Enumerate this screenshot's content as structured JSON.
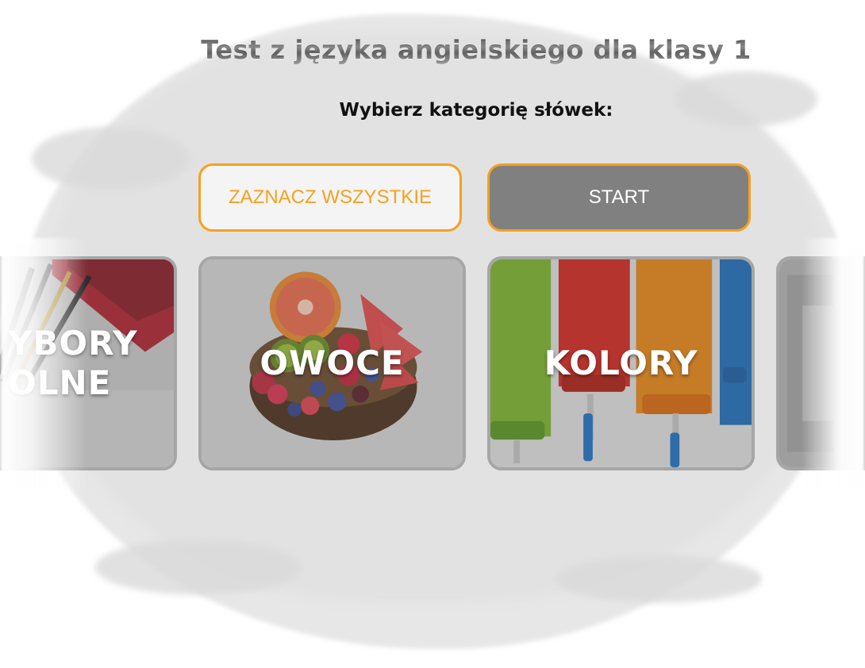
{
  "header": {
    "title": "Test z języka angielskiego dla klasy 1",
    "subtitle": "Wybierz kategorię słówek:"
  },
  "actions": {
    "select_all_label": "ZAZNACZ WSZYSTKIE",
    "start_label": "START"
  },
  "categories": [
    {
      "label": "PRZYBORY\nSZKOLNE",
      "visible_label": "YBORY\nOLNE",
      "image": "school-supplies-image",
      "partially_visible": true
    },
    {
      "label": "OWOCE",
      "image": "fruit-bowl-image"
    },
    {
      "label": "KOLORY",
      "image": "paint-rollers-image"
    },
    {
      "label": "",
      "image": "next-category-image",
      "partially_visible": true
    }
  ],
  "colors": {
    "accent": "#f5a11f",
    "start_bg": "#808080",
    "card_border": "#a6a6a6",
    "brush_bg": "#e7e7e7"
  }
}
